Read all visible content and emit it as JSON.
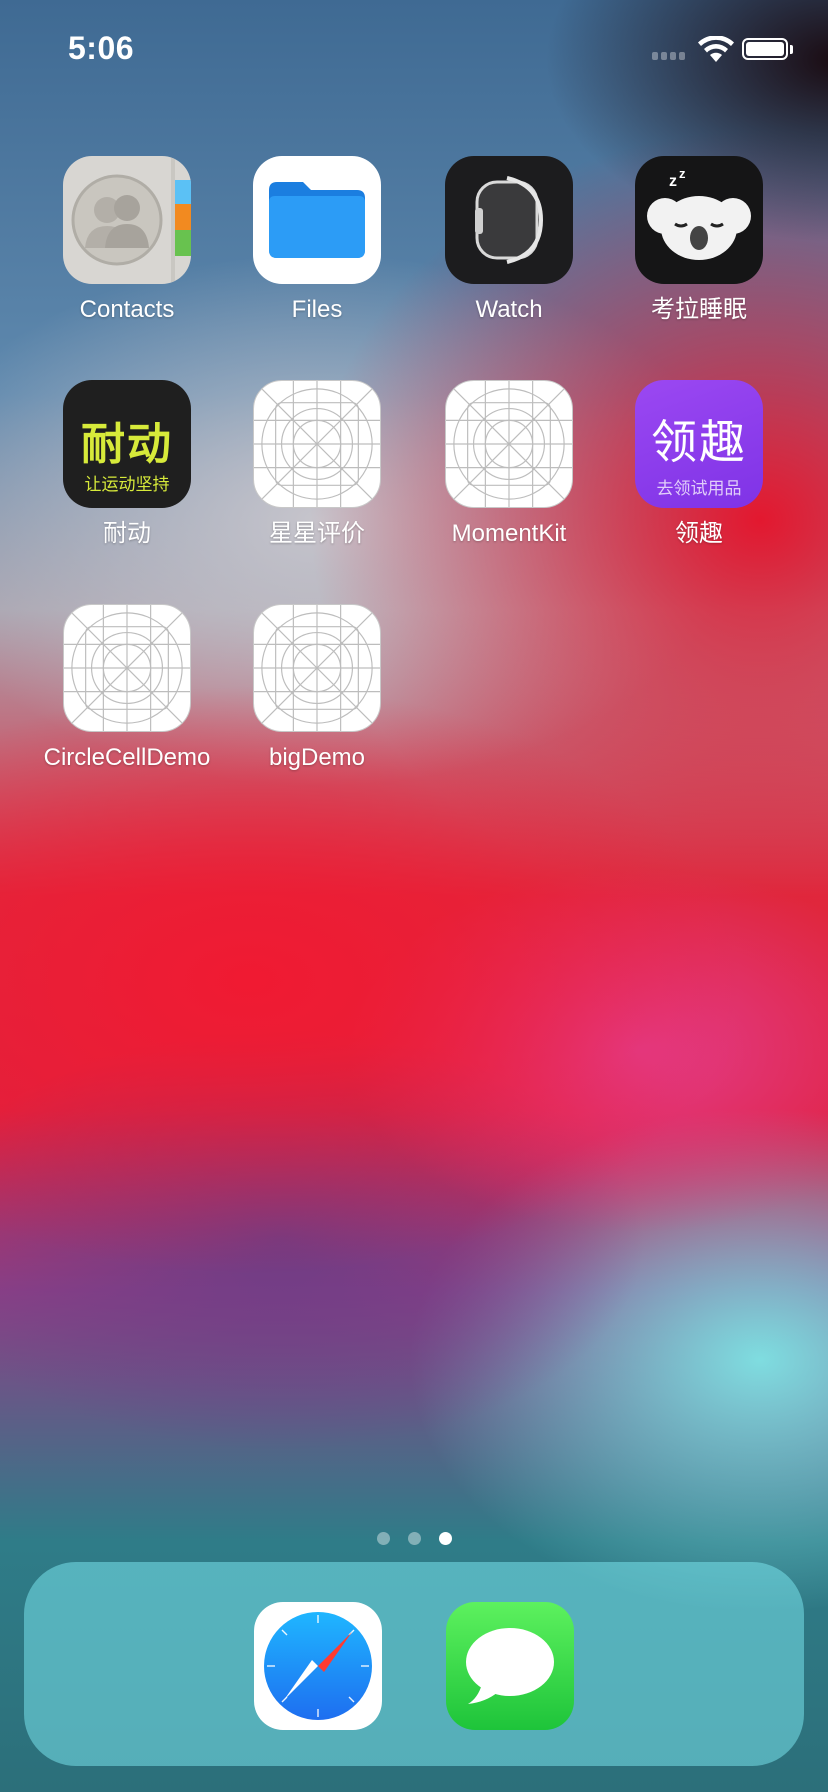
{
  "status_bar": {
    "time": "5:06",
    "icons": [
      "signal-icon",
      "wifi-icon",
      "battery-icon"
    ]
  },
  "apps": [
    {
      "label": "Contacts",
      "icon": "contacts-icon"
    },
    {
      "label": "Files",
      "icon": "files-icon"
    },
    {
      "label": "Watch",
      "icon": "watch-icon"
    },
    {
      "label": "考拉睡眠",
      "icon": "koala-sleep-icon"
    },
    {
      "label": "耐动",
      "icon": "naidong-icon",
      "icon_text": "耐动",
      "icon_subtext": "让运动坚持"
    },
    {
      "label": "星星评价",
      "icon": "placeholder-app-icon"
    },
    {
      "label": "MomentKit",
      "icon": "placeholder-app-icon"
    },
    {
      "label": "领趣",
      "icon": "lingqu-icon",
      "icon_text": "领趣",
      "icon_subtext": "去领试用品"
    },
    {
      "label": "CircleCellDemo",
      "icon": "placeholder-app-icon"
    },
    {
      "label": "bigDemo",
      "icon": "placeholder-app-icon"
    }
  ],
  "page_indicator": {
    "pages": 3,
    "current": 3
  },
  "dock": [
    {
      "name": "Safari",
      "icon": "safari-icon"
    },
    {
      "name": "Messages",
      "icon": "messages-icon"
    }
  ],
  "colors": {
    "naidong_bg": "#1f1f1f",
    "naidong_text": "#d7ea3a",
    "lingqu_bg": "#8d3ff0",
    "files_blue": "#1d8ef0",
    "messages_green": "#35d24b",
    "safari_blue": "#1e88f5"
  }
}
